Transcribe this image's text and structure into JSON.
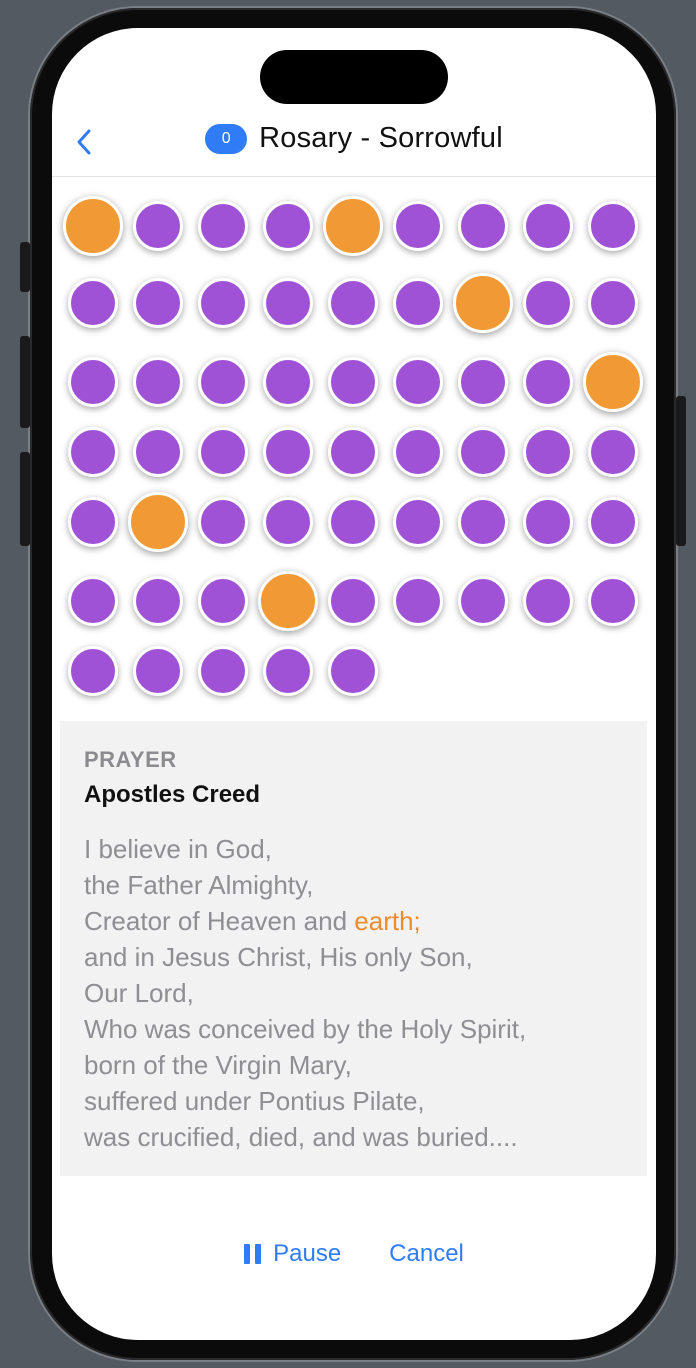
{
  "nav": {
    "back_icon": "chevron-left-icon",
    "count": "0",
    "title": "Rosary - Sorrowful"
  },
  "beads": {
    "rows": [
      [
        "large",
        "small",
        "small",
        "small",
        "large",
        "small",
        "small",
        "small",
        "small"
      ],
      [
        "small",
        "small",
        "small",
        "small",
        "small",
        "small",
        "large",
        "small",
        "small"
      ],
      [
        "small",
        "small",
        "small",
        "small",
        "small",
        "small",
        "small",
        "small",
        "large"
      ],
      [
        "small",
        "small",
        "small",
        "small",
        "small",
        "small",
        "small",
        "small",
        "small"
      ],
      [
        "small",
        "large",
        "small",
        "small",
        "small",
        "small",
        "small",
        "small",
        "small"
      ],
      [
        "small",
        "small",
        "small",
        "large",
        "small",
        "small",
        "small",
        "small",
        "small"
      ],
      [
        "small",
        "small",
        "small",
        "small",
        "small"
      ]
    ]
  },
  "prayer": {
    "caption": "PRAYER",
    "name": "Apostles Creed",
    "lines": [
      "I believe in God,",
      "the Father Almighty,",
      "Creator of Heaven and ",
      "and in Jesus Christ, His only Son,",
      "Our Lord,",
      "Who was conceived by the Holy Spirit,",
      "born of the Virgin Mary,",
      "suffered under Pontius Pilate,",
      "was crucified, died, and was buried...."
    ],
    "highlight_word": "earth;"
  },
  "controls": {
    "pause_icon": "pause-icon",
    "pause_label": "Pause",
    "cancel_label": "Cancel"
  },
  "colors": {
    "accent": "#2f7cf6",
    "bead_small": "#a052d7",
    "bead_large": "#f19a35",
    "highlight": "#ef8b2b"
  }
}
